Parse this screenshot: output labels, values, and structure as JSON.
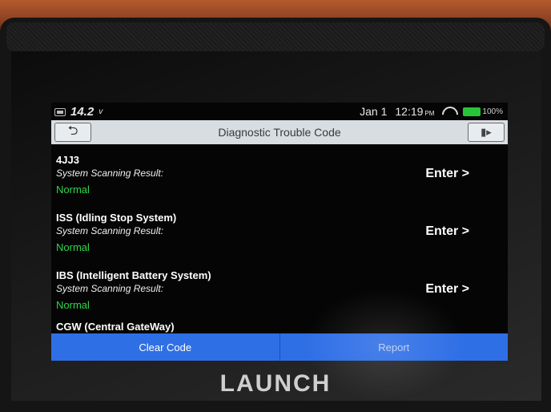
{
  "status": {
    "voltage": "14.2",
    "voltage_unit": "v",
    "date": "Jan 1",
    "time": "12:19",
    "ampm": "PM",
    "battery_pct": "100%",
    "icons": [
      "battery-indicator-icon",
      "wifi-icon",
      "battery-icon"
    ]
  },
  "header": {
    "title": "Diagnostic Trouble Code",
    "back_icon": "back-arrow-icon",
    "exit_icon": "exit-door-icon"
  },
  "systems": [
    {
      "name": "4JJ3",
      "label": "System Scanning Result:",
      "result": "Normal",
      "action": "Enter >"
    },
    {
      "name": "ISS (Idling Stop System)",
      "label": "System Scanning Result:",
      "result": "Normal",
      "action": "Enter >"
    },
    {
      "name": "IBS (Intelligent Battery System)",
      "label": "System Scanning Result:",
      "result": "Normal",
      "action": "Enter >"
    },
    {
      "name": "CGW (Central GateWay)"
    }
  ],
  "actions": {
    "clear_code": "Clear Code",
    "report": "Report"
  },
  "device": {
    "brand": "LAUNCH"
  },
  "colors": {
    "accent_blue": "#2f6fe6",
    "normal_green": "#2fd34d",
    "title_bar": "#d8dde2"
  }
}
